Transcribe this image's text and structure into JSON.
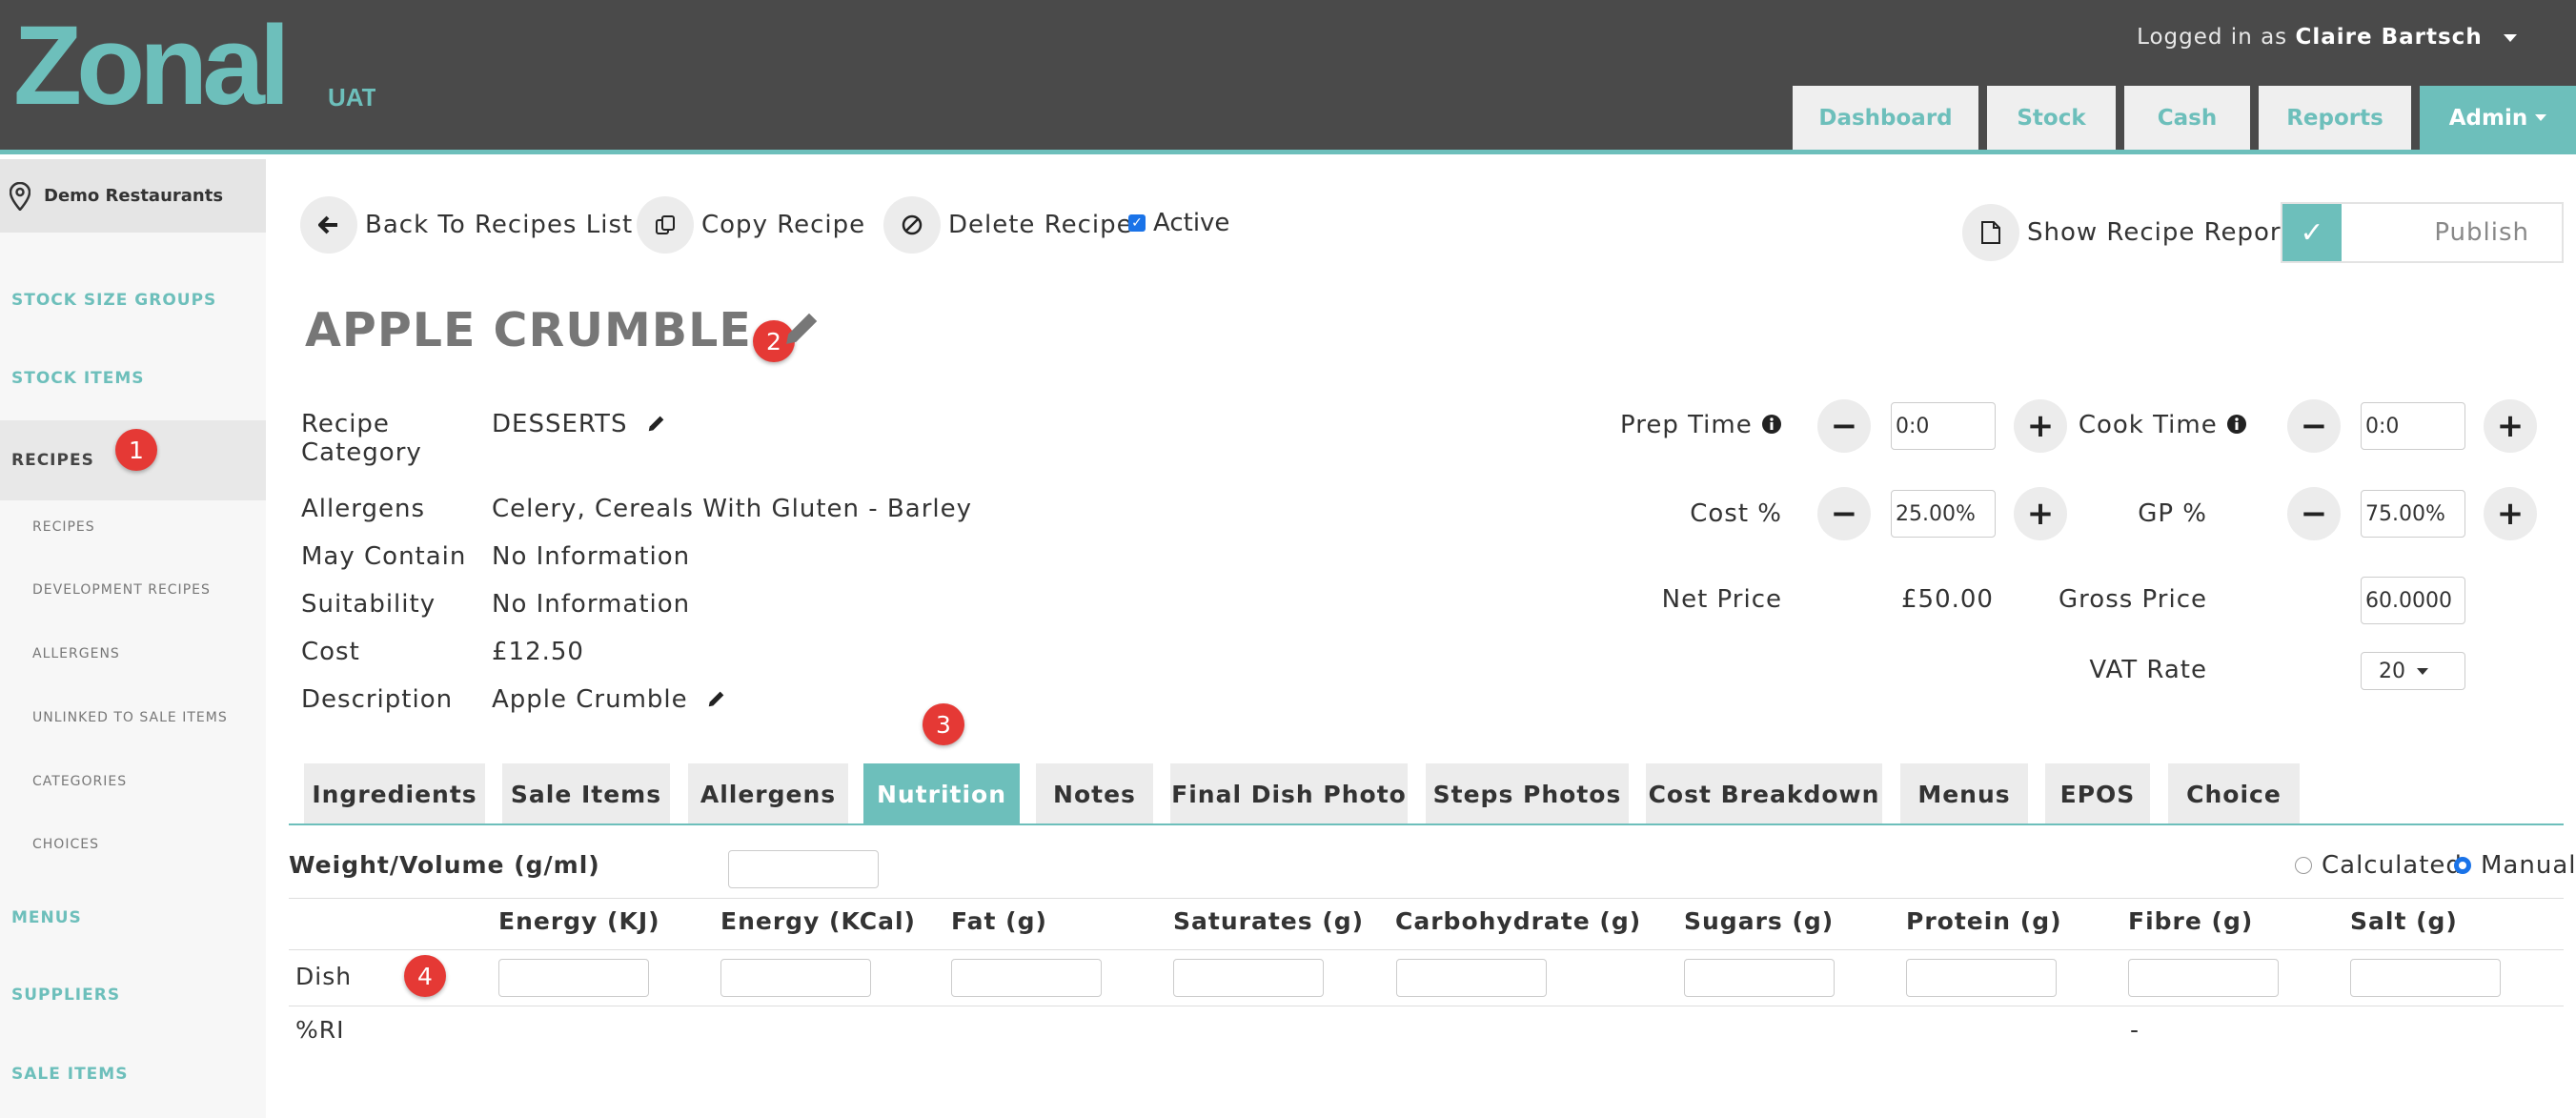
{
  "header": {
    "logo_text": "Zonal",
    "logo_env": "UAT",
    "logged_in_prefix": "Logged in as",
    "user_name": "Claire Bartsch",
    "nav": [
      "Dashboard",
      "Stock",
      "Cash",
      "Reports",
      "Admin"
    ]
  },
  "sidebar": {
    "location": "Demo Restaurants",
    "items": [
      "STOCK SIZE GROUPS",
      "STOCK ITEMS",
      "RECIPES",
      "MENUS",
      "SUPPLIERS",
      "SALE ITEMS"
    ],
    "sub_items": [
      "RECIPES",
      "DEVELOPMENT RECIPES",
      "ALLERGENS",
      "UNLINKED TO SALE ITEMS",
      "CATEGORIES",
      "CHOICES"
    ]
  },
  "badges": [
    "1",
    "2",
    "3",
    "4"
  ],
  "actions": {
    "back": "Back To Recipes List",
    "copy": "Copy Recipe",
    "delete": "Delete Recipe",
    "active": "Active",
    "report": "Show Recipe Report",
    "publish": "Publish"
  },
  "recipe": {
    "title": "APPLE CRUMBLE",
    "fields": {
      "category_label_1": "Recipe",
      "category_label_2": "Category",
      "category": "DESSERTS",
      "allergens_label": "Allergens",
      "allergens": "Celery, Cereals With Gluten - Barley",
      "may_contain_label": "May Contain",
      "may_contain": "No Information",
      "suitability_label": "Suitability",
      "suitability": "No Information",
      "cost_label": "Cost",
      "cost": "£12.50",
      "description_label": "Description",
      "description": "Apple Crumble"
    },
    "pricing": {
      "prep_time_label": "Prep Time",
      "prep_time": "0:0",
      "cook_time_label": "Cook Time",
      "cook_time": "0:0",
      "cost_pct_label": "Cost %",
      "cost_pct": "25.00%",
      "gp_pct_label": "GP %",
      "gp_pct": "75.00%",
      "net_price_label": "Net Price",
      "net_price": "£50.00",
      "gross_price_label": "Gross Price",
      "gross_price": "60.0000",
      "vat_label": "VAT Rate",
      "vat": "20"
    }
  },
  "tabs": [
    "Ingredients",
    "Sale Items",
    "Allergens",
    "Nutrition",
    "Notes",
    "Final Dish Photo",
    "Steps Photos",
    "Cost Breakdown",
    "Menus",
    "EPOS",
    "Choice"
  ],
  "nutrition": {
    "weight_label": "Weight/Volume (g/ml)",
    "weight_value": "",
    "mode_calculated": "Calculated",
    "mode_manual": "Manual",
    "columns": [
      "Energy (KJ)",
      "Energy (KCal)",
      "Fat (g)",
      "Saturates (g)",
      "Carbohydrate (g)",
      "Sugars (g)",
      "Protein (g)",
      "Fibre (g)",
      "Salt (g)"
    ],
    "row_dish": "Dish",
    "row_ri": "%RI",
    "ri_fibre": "-"
  },
  "colors": {
    "accent": "#6dbfbb",
    "header_bg": "#4a4a4a",
    "badge": "#e53935"
  }
}
